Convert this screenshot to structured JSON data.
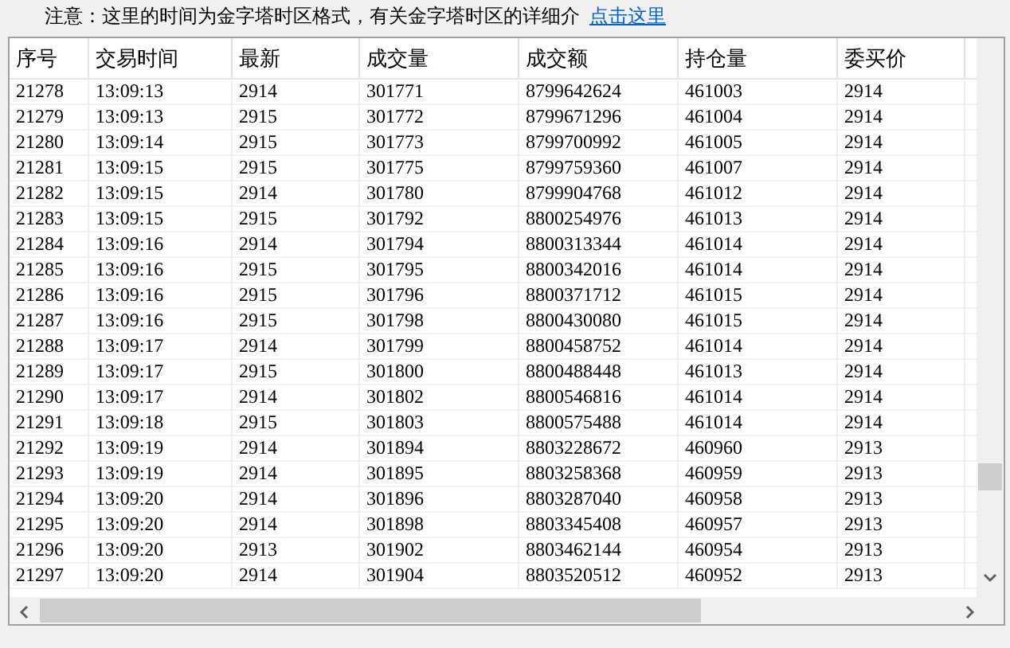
{
  "notice": {
    "text": "注意：这里的时间为金字塔时区格式，有关金字塔时区的详细介",
    "link": "点击这里"
  },
  "table": {
    "columns": [
      "序号",
      "交易时间",
      "最新",
      "成交量",
      "成交额",
      "持仓量",
      "委买价"
    ],
    "rows": [
      [
        "21278",
        "13:09:13",
        "2914",
        "301771",
        "8799642624",
        "461003",
        "2914"
      ],
      [
        "21279",
        "13:09:13",
        "2915",
        "301772",
        "8799671296",
        "461004",
        "2914"
      ],
      [
        "21280",
        "13:09:14",
        "2915",
        "301773",
        "8799700992",
        "461005",
        "2914"
      ],
      [
        "21281",
        "13:09:15",
        "2915",
        "301775",
        "8799759360",
        "461007",
        "2914"
      ],
      [
        "21282",
        "13:09:15",
        "2914",
        "301780",
        "8799904768",
        "461012",
        "2914"
      ],
      [
        "21283",
        "13:09:15",
        "2915",
        "301792",
        "8800254976",
        "461013",
        "2914"
      ],
      [
        "21284",
        "13:09:16",
        "2914",
        "301794",
        "8800313344",
        "461014",
        "2914"
      ],
      [
        "21285",
        "13:09:16",
        "2915",
        "301795",
        "8800342016",
        "461014",
        "2914"
      ],
      [
        "21286",
        "13:09:16",
        "2915",
        "301796",
        "8800371712",
        "461015",
        "2914"
      ],
      [
        "21287",
        "13:09:16",
        "2915",
        "301798",
        "8800430080",
        "461015",
        "2914"
      ],
      [
        "21288",
        "13:09:17",
        "2914",
        "301799",
        "8800458752",
        "461014",
        "2914"
      ],
      [
        "21289",
        "13:09:17",
        "2915",
        "301800",
        "8800488448",
        "461013",
        "2914"
      ],
      [
        "21290",
        "13:09:17",
        "2914",
        "301802",
        "8800546816",
        "461014",
        "2914"
      ],
      [
        "21291",
        "13:09:18",
        "2915",
        "301803",
        "8800575488",
        "461014",
        "2914"
      ],
      [
        "21292",
        "13:09:19",
        "2914",
        "301894",
        "8803228672",
        "460960",
        "2913"
      ],
      [
        "21293",
        "13:09:19",
        "2914",
        "301895",
        "8803258368",
        "460959",
        "2913"
      ],
      [
        "21294",
        "13:09:20",
        "2914",
        "301896",
        "8803287040",
        "460958",
        "2913"
      ],
      [
        "21295",
        "13:09:20",
        "2914",
        "301898",
        "8803345408",
        "460957",
        "2913"
      ],
      [
        "21296",
        "13:09:20",
        "2913",
        "301902",
        "8803462144",
        "460954",
        "2913"
      ],
      [
        "21297",
        "13:09:20",
        "2914",
        "301904",
        "8803520512",
        "460952",
        "2913"
      ]
    ]
  }
}
